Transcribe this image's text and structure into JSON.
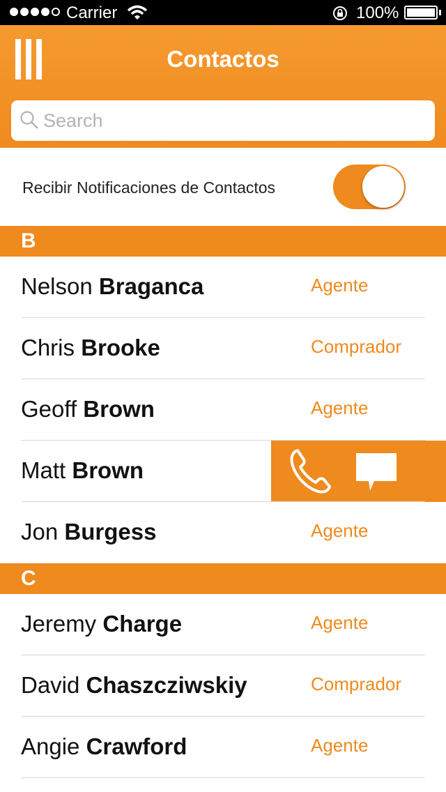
{
  "status_bar": {
    "carrier": "Carrier",
    "battery_percent": "100%",
    "signal_bars_filled": 4,
    "signal_bars_total": 5
  },
  "nav": {
    "title": "Contactos",
    "menu_icon": "hamburger-icon"
  },
  "search": {
    "placeholder": "Search",
    "value": ""
  },
  "notifications": {
    "label": "Recibir Notificaciones de Contactos",
    "enabled": true
  },
  "accent_color": "#ef8a1e",
  "sections": [
    {
      "letter": "B",
      "contacts": [
        {
          "first": "Nelson",
          "last": "Braganca",
          "role": "Agente"
        },
        {
          "first": "Chris",
          "last": "Brooke",
          "role": "Comprador"
        },
        {
          "first": "Geoff",
          "last": "Brown",
          "role": "Agente"
        },
        {
          "first": "Matt",
          "last": "Brown",
          "role": "",
          "swipe_actions": [
            "phone-icon",
            "message-icon"
          ]
        },
        {
          "first": "Jon",
          "last": "Burgess",
          "role": "Agente"
        }
      ]
    },
    {
      "letter": "C",
      "contacts": [
        {
          "first": "Jeremy",
          "last": "Charge",
          "role": "Agente"
        },
        {
          "first": "David",
          "last": "Chaszcziwskiy",
          "role": "Comprador"
        },
        {
          "first": "Angie",
          "last": "Crawford",
          "role": "Agente"
        }
      ]
    }
  ]
}
